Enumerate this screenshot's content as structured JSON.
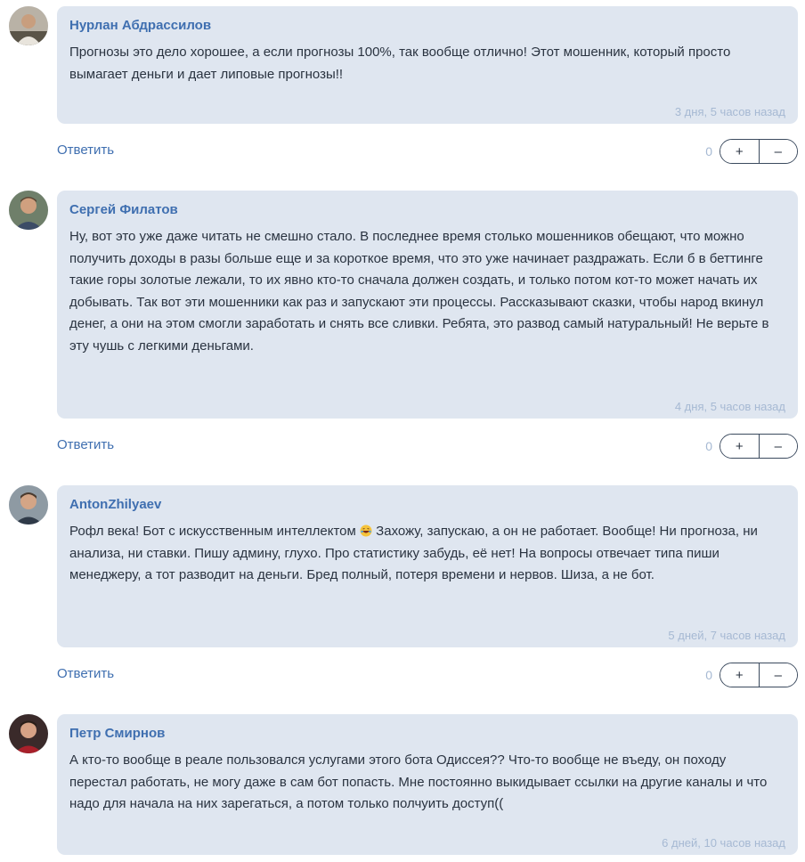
{
  "comments": [
    {
      "author": "Нурлан Абдрассилов",
      "text": "Прогнозы это дело хорошее, а если прогнозы 100%, так вообще отлично! Этот мошенник, который просто вымагает деньги и дает липовые прогнозы!!",
      "time": "3 дня, 5 часов назад",
      "reply_label": "Ответить",
      "votes": "0",
      "plus_label": "+",
      "minus_label": "–"
    },
    {
      "author": "Сергей Филатов",
      "text": "Ну, вот это уже даже читать не смешно стало. В последнее время столько мошенников обещают, что можно получить доходы в разы больше еще и за короткое время, что это уже начинает раздражать. Если б в беттинге такие горы золотые лежали, то их явно кто-то сначала должен создать, и только потом кот-то может начать их добывать. Так вот эти мошенники как раз и запускают эти процессы. Рассказывают сказки, чтобы народ вкинул денег, а они на этом смогли заработать и снять все сливки. Ребята, это развод самый натуральный! Не верьте в эту чушь с легкими деньгами.",
      "time": "4 дня, 5 часов назад",
      "reply_label": "Ответить",
      "votes": "0",
      "plus_label": "+",
      "minus_label": "–"
    },
    {
      "author": "AntonZhilyaev",
      "text_before": "Рофл века! Бот с искусственным интеллектом",
      "emoji": "laughing-face-emoji",
      "text_after": "Захожу, запускаю, а он не работает. Вообще! Ни прогноза, ни анализа, ни ставки. Пишу админу, глухо. Про статистику забудь, её нет! На вопросы отвечает типа пиши менеджеру, а тот разводит на деньги. Бред полный, потеря времени и нервов. Шиза, а не бот.",
      "time": "5 дней, 7 часов назад",
      "reply_label": "Ответить",
      "votes": "0",
      "plus_label": "+",
      "minus_label": "–"
    },
    {
      "author": "Петр Смирнов",
      "text": "А кто-то вообще в реале пользовался услугами этого бота Одиссея?? Что-то вообще не въеду, он походу перестал работать, не могу даже в сам бот попасть. Мне постоянно выкидывает ссылки на другие каналы и что надо для начала на них зарегаться, а потом только полчуить доступ((",
      "time": "6 дней, 10 часов назад"
    }
  ],
  "colors": {
    "bubble": "#dfe6f0",
    "author": "#3f6fb0",
    "timestamp": "#a6b9d3",
    "link": "#3f6fb0"
  }
}
